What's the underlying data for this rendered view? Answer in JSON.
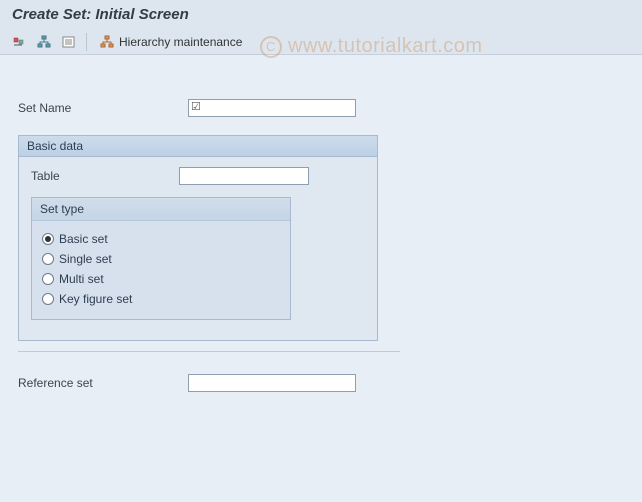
{
  "title": "Create Set: Initial Screen",
  "toolbar": {
    "hierarchy_label": "Hierarchy maintenance"
  },
  "fields": {
    "set_name_label": "Set Name",
    "set_name_value": "",
    "reference_set_label": "Reference set",
    "reference_set_value": ""
  },
  "basic_data": {
    "group_title": "Basic data",
    "table_label": "Table",
    "table_value": "",
    "set_type": {
      "title": "Set type",
      "options": [
        {
          "label": "Basic set",
          "value": "basic",
          "checked": true
        },
        {
          "label": "Single set",
          "value": "single",
          "checked": false
        },
        {
          "label": "Multi set",
          "value": "multi",
          "checked": false
        },
        {
          "label": "Key figure set",
          "value": "keyfigure",
          "checked": false
        }
      ]
    }
  },
  "watermark": "www.tutorialkart.com"
}
